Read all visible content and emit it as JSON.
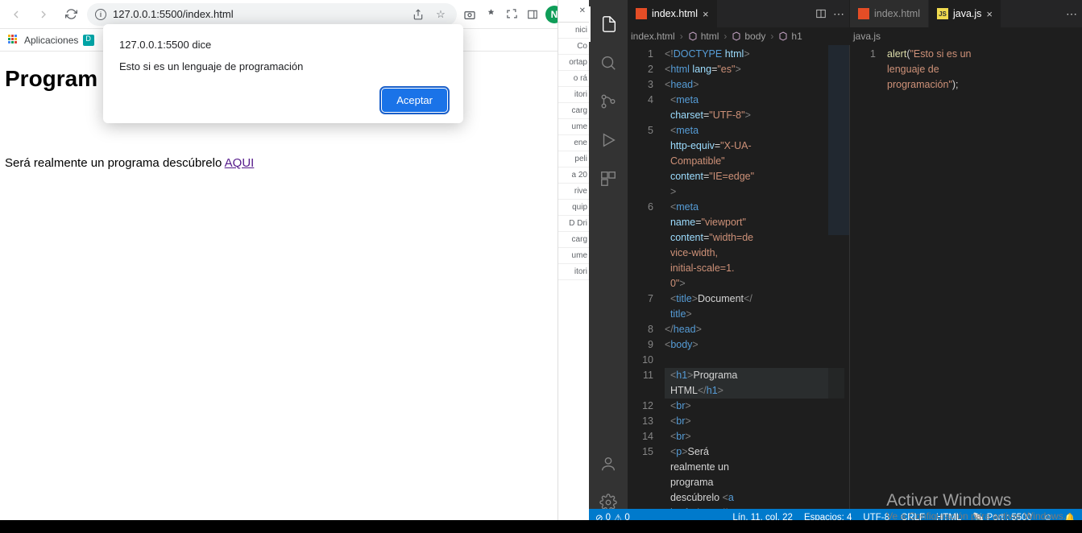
{
  "browser": {
    "url": "127.0.0.1:5500/index.html",
    "bookmarks": {
      "apps": "Aplicaciones"
    },
    "avatar_letter": "N",
    "page": {
      "h1_visible": "Program",
      "p_prefix": "Será realmente un programa descúbrelo ",
      "link_text": "AQUI"
    },
    "alert": {
      "title": "127.0.0.1:5500 dice",
      "message": "Esto si es un lenguaje de programación",
      "accept": "Aceptar"
    },
    "download_hints": [
      "nici",
      "Co",
      "ortap",
      "o rá",
      "itori",
      "carg",
      "ume",
      "ene",
      "peli",
      "a 20",
      "rive",
      "quip",
      "D Dri",
      "carg",
      "ume",
      "itori"
    ]
  },
  "vscode": {
    "tabs_left": {
      "name": "index.html"
    },
    "tabs_right_a": {
      "name": "index.html"
    },
    "tabs_right_b": {
      "name": "java.js"
    },
    "breadcrumb_left": [
      "index.html",
      "html",
      "body",
      "h1"
    ],
    "breadcrumb_right": [
      "java.js"
    ],
    "left_lines": [
      {
        "n": "1",
        "html": "<span class='t-brkt'>&lt;!</span><span class='t-tag'>DOCTYPE</span> <span class='t-attr'>html</span><span class='t-brkt'>&gt;</span>"
      },
      {
        "n": "2",
        "html": "<span class='t-brkt'>&lt;</span><span class='t-tag'>html</span> <span class='t-attr'>lang</span>=<span class='t-str'>\"es\"</span><span class='t-brkt'>&gt;</span>"
      },
      {
        "n": "3",
        "html": "<span class='t-brkt'>&lt;</span><span class='t-tag'>head</span><span class='t-brkt'>&gt;</span>"
      },
      {
        "n": "4",
        "html": "  <span class='t-brkt'>&lt;</span><span class='t-tag'>meta</span> <br>  <span class='t-attr'>charset</span>=<span class='t-str'>\"UTF-8\"</span><span class='t-brkt'>&gt;</span>"
      },
      {
        "n": "5",
        "html": "  <span class='t-brkt'>&lt;</span><span class='t-tag'>meta</span> <br>  <span class='t-attr'>http-equiv</span>=<span class='t-str'>\"X-UA-<br>  Compatible\"</span> <br>  <span class='t-attr'>content</span>=<span class='t-str'>\"IE=edge\"</span><br>  <span class='t-brkt'>&gt;</span>"
      },
      {
        "n": "6",
        "html": "  <span class='t-brkt'>&lt;</span><span class='t-tag'>meta</span> <br>  <span class='t-attr'>name</span>=<span class='t-str'>\"viewport\"</span> <br>  <span class='t-attr'>content</span>=<span class='t-str'>\"width=de<br>  vice-width, <br>  initial-scale=1.<br>  0\"</span><span class='t-brkt'>&gt;</span>"
      },
      {
        "n": "7",
        "html": "  <span class='t-brkt'>&lt;</span><span class='t-tag'>title</span><span class='t-brkt'>&gt;</span>Document<span class='t-brkt'>&lt;/</span><br>  <span class='t-tag'>title</span><span class='t-brkt'>&gt;</span>"
      },
      {
        "n": "8",
        "html": "<span class='t-brkt'>&lt;/</span><span class='t-tag'>head</span><span class='t-brkt'>&gt;</span>"
      },
      {
        "n": "9",
        "html": "<span class='t-brkt'>&lt;</span><span class='t-tag'>body</span><span class='t-brkt'>&gt;</span>"
      },
      {
        "n": "10",
        "html": " "
      },
      {
        "n": "11",
        "html": "  <span class='t-brkt'>&lt;</span><span class='t-tag'>h1</span><span class='t-brkt'>&gt;</span>Programa <br>  HTML<span class='t-brkt'>&lt;/</span><span class='t-tag'>h1</span><span class='t-brkt'>&gt;</span>",
        "hl": true
      },
      {
        "n": "12",
        "html": "  <span class='t-brkt'>&lt;</span><span class='t-tag'>br</span><span class='t-brkt'>&gt;</span>"
      },
      {
        "n": "13",
        "html": "  <span class='t-brkt'>&lt;</span><span class='t-tag'>br</span><span class='t-brkt'>&gt;</span>"
      },
      {
        "n": "14",
        "html": "  <span class='t-brkt'>&lt;</span><span class='t-tag'>br</span><span class='t-brkt'>&gt;</span>"
      },
      {
        "n": "15",
        "html": "  <span class='t-brkt'>&lt;</span><span class='t-tag'>p</span><span class='t-brkt'>&gt;</span>Será <br>  realmente un <br>  programa <br>  descúbrelo <span class='t-brkt'>&lt;</span><span class='t-tag'>a</span> <br>  <span class='t-attr'>href</span>=<span class='t-str'>\"https://es</span>"
      }
    ],
    "right_lines": [
      {
        "n": "1",
        "html": "<span class='t-fn'>alert</span>(<span class='t-str'>\"Esto si es un <br>lenguaje de <br>programación\"</span>);"
      }
    ],
    "status": {
      "errors": "0",
      "warnings": "0",
      "ln_col": "Lín. 11, col. 22",
      "spaces": "Espacios: 4",
      "encoding": "UTF-8",
      "eol": "CRLF",
      "lang": "HTML",
      "port": "Port : 5500"
    }
  },
  "watermark": {
    "line1": "Activar Windows",
    "line2": "Ve a Configuración para activar Windows."
  }
}
